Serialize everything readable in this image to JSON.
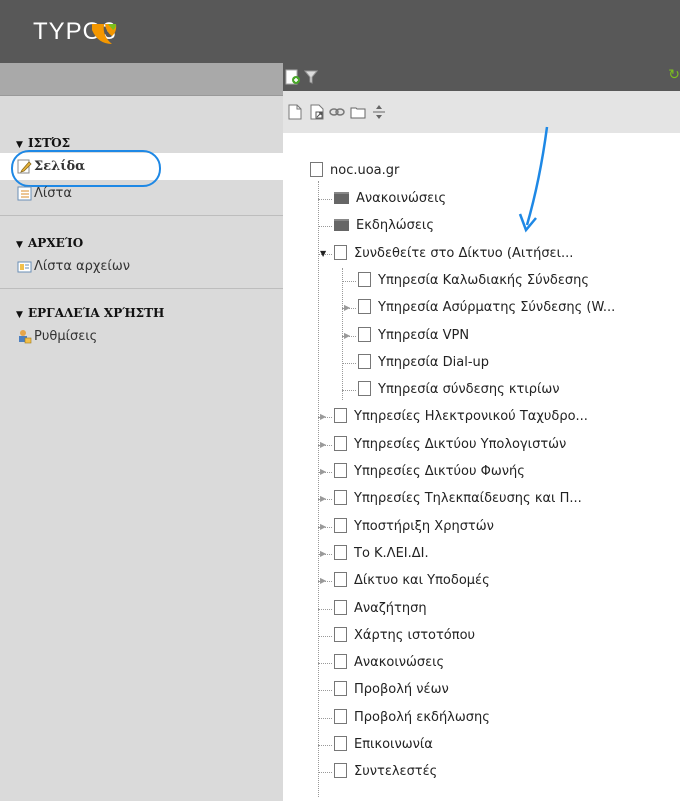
{
  "app": {
    "logo_text": "TYPO3"
  },
  "module_menu": {
    "sections": [
      {
        "title": "ΙΣΤΌΣ",
        "items": [
          {
            "label": "Σελίδα",
            "icon": "page-edit-icon",
            "active": true
          },
          {
            "label": "Λίστα",
            "icon": "list-icon",
            "active": false
          }
        ]
      },
      {
        "title": "ΑΡΧΕΊΟ",
        "items": [
          {
            "label": "Λίστα αρχείων",
            "icon": "filelist-icon",
            "active": false
          }
        ]
      },
      {
        "title": "ΕΡΓΑΛΕΊΑ ΧΡΉΣΤΗ",
        "items": [
          {
            "label": "Ρυθμίσεις",
            "icon": "user-settings-icon",
            "active": false
          }
        ]
      }
    ]
  },
  "tree_toolbar": {
    "top_icons": [
      "new-page-icon",
      "filter-icon"
    ],
    "icons": [
      "page-icon",
      "page-shortcut-icon",
      "link-icon",
      "folder-icon",
      "drag-separator-icon"
    ]
  },
  "page_tree": {
    "root": "noc.uoa.gr",
    "nodes": [
      {
        "label": "Ανακοινώσεις",
        "type": "folder",
        "expander": "none",
        "depth": 1
      },
      {
        "label": "Εκδηλώσεις",
        "type": "folder",
        "expander": "none",
        "depth": 1
      },
      {
        "label": "Συνδεθείτε στο Δίκτυο (Αιτήσει...",
        "type": "page",
        "expander": "open",
        "depth": 1
      },
      {
        "label": "Υπηρεσία Καλωδιακής Σύνδεσης",
        "type": "page",
        "expander": "none",
        "depth": 2
      },
      {
        "label": "Υπηρεσία Ασύρματης Σύνδεσης (W...",
        "type": "page",
        "expander": "closed",
        "depth": 2
      },
      {
        "label": "Υπηρεσία VPN",
        "type": "page",
        "expander": "closed",
        "depth": 2
      },
      {
        "label": "Υπηρεσία Dial-up",
        "type": "page",
        "expander": "none",
        "depth": 2
      },
      {
        "label": "Υπηρεσία σύνδεσης κτιρίων",
        "type": "page",
        "expander": "none",
        "depth": 2
      },
      {
        "label": "Υπηρεσίες Ηλεκτρονικού Ταχυδρο...",
        "type": "page",
        "expander": "closed",
        "depth": 1
      },
      {
        "label": "Υπηρεσίες Δικτύου Υπολογιστών",
        "type": "page",
        "expander": "closed",
        "depth": 1
      },
      {
        "label": "Υπηρεσίες Δικτύου Φωνής",
        "type": "page",
        "expander": "closed",
        "depth": 1
      },
      {
        "label": "Υπηρεσίες Τηλεκπαίδευσης και Π...",
        "type": "page",
        "expander": "closed",
        "depth": 1
      },
      {
        "label": "Υποστήριξη Χρηστών",
        "type": "page",
        "expander": "closed",
        "depth": 1
      },
      {
        "label": "Το Κ.ΛΕΙ.ΔΙ.",
        "type": "page",
        "expander": "closed",
        "depth": 1
      },
      {
        "label": "Δίκτυο και Υποδομές",
        "type": "page",
        "expander": "closed",
        "depth": 1
      },
      {
        "label": "Αναζήτηση",
        "type": "page",
        "expander": "none",
        "depth": 1
      },
      {
        "label": "Χάρτης ιστοτόπου",
        "type": "page",
        "expander": "none",
        "depth": 1
      },
      {
        "label": "Ανακοινώσεις",
        "type": "page",
        "expander": "none",
        "depth": 1
      },
      {
        "label": "Προβολή νέων",
        "type": "page",
        "expander": "none",
        "depth": 1
      },
      {
        "label": "Προβολή εκδήλωσης",
        "type": "page",
        "expander": "none",
        "depth": 1
      },
      {
        "label": "Επικοινωνία",
        "type": "page",
        "expander": "none",
        "depth": 1
      },
      {
        "label": "Συντελεστές",
        "type": "page",
        "expander": "none",
        "depth": 1
      }
    ]
  },
  "annotations": {
    "ring_color": "#1e88e5",
    "arrow_color": "#1e88e5"
  }
}
